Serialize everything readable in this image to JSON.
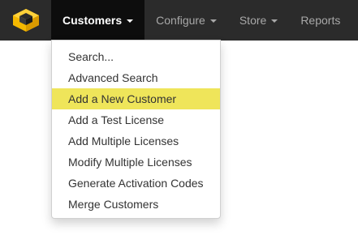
{
  "navbar": {
    "logo_icon": "yellow-cubes-logo-icon",
    "items": [
      {
        "label": "Customers",
        "active": true
      },
      {
        "label": "Configure",
        "active": false
      },
      {
        "label": "Store",
        "active": false
      },
      {
        "label": "Reports",
        "active": false
      }
    ]
  },
  "dropdown": {
    "items": [
      {
        "label": "Search..."
      },
      {
        "label": "Advanced Search"
      },
      {
        "label": "Add a New Customer",
        "highlighted": true
      },
      {
        "label": "Add a Test License"
      },
      {
        "label": "Add Multiple Licenses"
      },
      {
        "label": "Modify Multiple Licenses"
      },
      {
        "label": "Generate Activation Codes"
      },
      {
        "label": "Merge Customers"
      }
    ],
    "highlight_color": "#efe55a"
  },
  "colors": {
    "navbar_bg": "#2b2b2b",
    "active_bg": "#0d0d0d",
    "logo_yellow": "#f5b800"
  }
}
